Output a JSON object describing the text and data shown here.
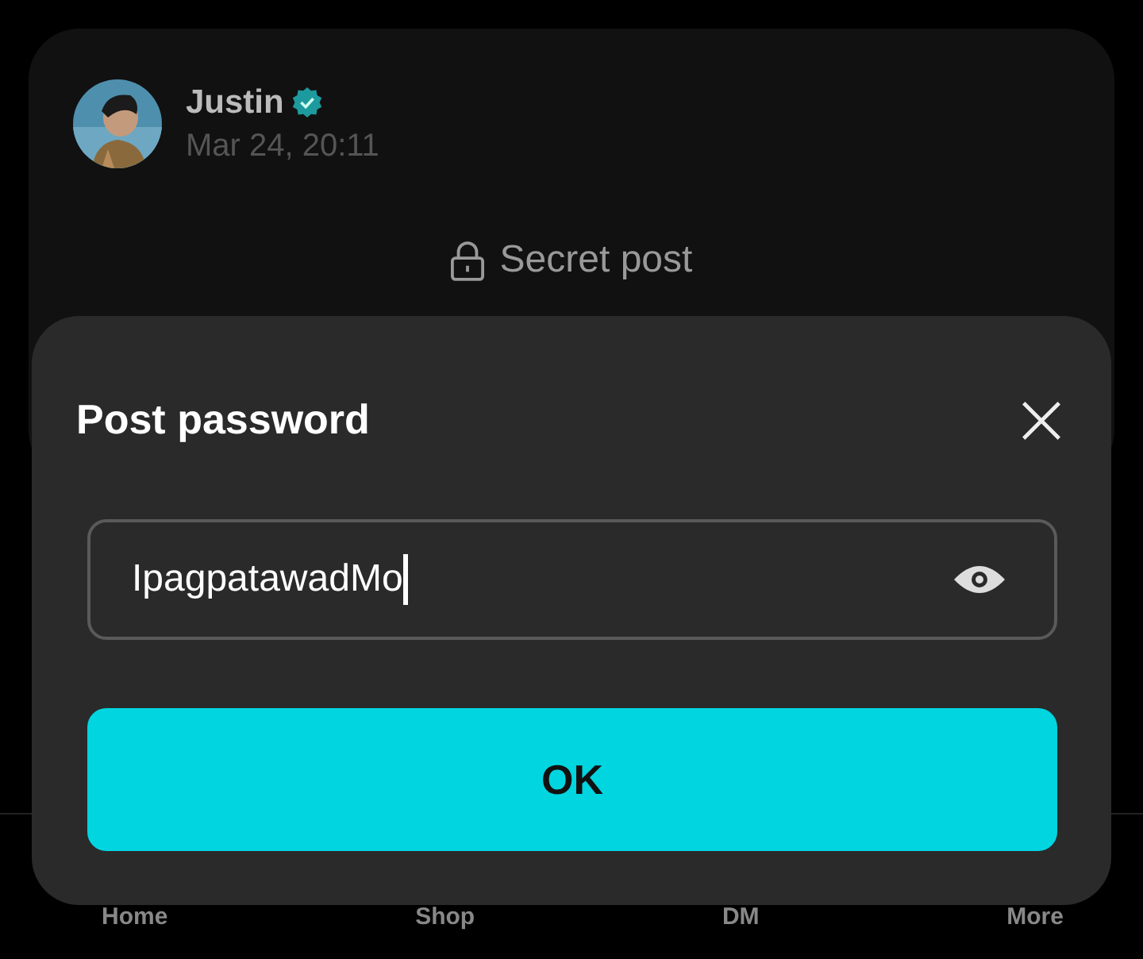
{
  "post": {
    "author": "Justin",
    "verified": true,
    "time": "Mar 24, 20:11",
    "locked_title": "Secret post"
  },
  "dialog": {
    "title": "Post password",
    "password": {
      "value": "IpagpatawadMo",
      "focused": true
    },
    "button": "OK"
  },
  "nav": [
    {
      "label": "Home"
    },
    {
      "label": "Shop"
    },
    {
      "label": "DM"
    },
    {
      "label": "More"
    }
  ]
}
